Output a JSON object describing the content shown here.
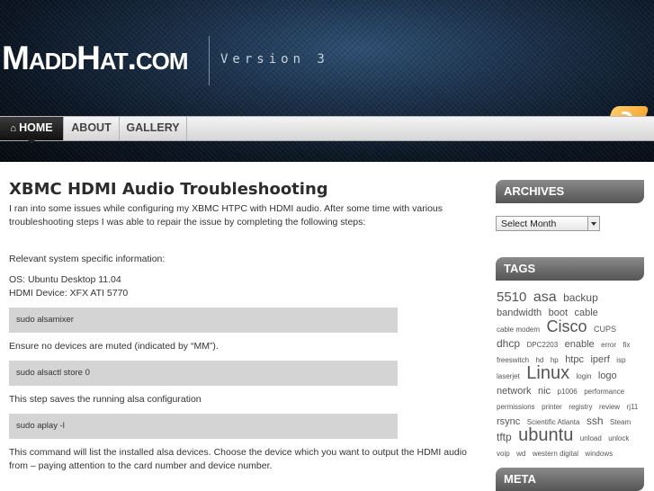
{
  "header": {
    "logo": "MaddHat.com",
    "tagline": "Version 3"
  },
  "nav": {
    "items": [
      {
        "label": "HOME",
        "active": true
      },
      {
        "label": "ABOUT",
        "active": false
      },
      {
        "label": "GALLERY",
        "active": false
      }
    ]
  },
  "post": {
    "title": "XBMC HDMI Audio Troubleshooting",
    "intro": "I ran into some issues while configuring my XBMC HTPC with HDMI audio.  After some time with various troubleshooting steps I was able to repair the issue by completing the following steps:",
    "relevant": "Relevant system specific information:",
    "os": "OS: Ubuntu Desktop 11.04",
    "hdmi": "HDMI Device: XFX ATI 5770",
    "cmd1": "sudo alsamixer",
    "note1": "Ensure no devices are muted (indicated by “MM”).",
    "cmd2": "sudo alsactl store 0",
    "note2": "This step saves the running alsa configuration",
    "cmd3": "sudo aplay -l",
    "note3": "This command will list the installed alsa devices.  Choose the device which you want to output the HDMI audio from – paying attention to the card number and device number."
  },
  "sidebar": {
    "archives_title": "ARCHIVES",
    "select_placeholder": "Select Month",
    "tags_title": "TAGS",
    "meta_title": "META",
    "tags": [
      {
        "t": "5510",
        "s": 15
      },
      {
        "t": "asa",
        "s": 16
      },
      {
        "t": "backup",
        "s": 12
      },
      {
        "t": "bandwidth",
        "s": 11
      },
      {
        "t": "boot",
        "s": 11
      },
      {
        "t": "cable",
        "s": 11
      },
      {
        "t": "cable modem",
        "s": 8
      },
      {
        "t": "Cisco",
        "s": 18
      },
      {
        "t": "CUPS",
        "s": 9
      },
      {
        "t": "dhcp",
        "s": 12
      },
      {
        "t": "DPC2203",
        "s": 8
      },
      {
        "t": "enable",
        "s": 11
      },
      {
        "t": "error",
        "s": 8
      },
      {
        "t": "fix",
        "s": 8
      },
      {
        "t": "freeswitch",
        "s": 8
      },
      {
        "t": "hd",
        "s": 8
      },
      {
        "t": "hp",
        "s": 8
      },
      {
        "t": "htpc",
        "s": 11
      },
      {
        "t": "iperf",
        "s": 11
      },
      {
        "t": "isp",
        "s": 8
      },
      {
        "t": "laserjet",
        "s": 8
      },
      {
        "t": "Linux",
        "s": 20
      },
      {
        "t": "login",
        "s": 8
      },
      {
        "t": "logo",
        "s": 11
      },
      {
        "t": "network",
        "s": 11
      },
      {
        "t": "nic",
        "s": 11
      },
      {
        "t": "p1006",
        "s": 8
      },
      {
        "t": "performance",
        "s": 8
      },
      {
        "t": "permissions",
        "s": 8
      },
      {
        "t": "printer",
        "s": 8
      },
      {
        "t": "registry",
        "s": 8
      },
      {
        "t": "review",
        "s": 8
      },
      {
        "t": "rj11",
        "s": 8
      },
      {
        "t": "rsync",
        "s": 11
      },
      {
        "t": "Scientific Atlanta",
        "s": 8
      },
      {
        "t": "ssh",
        "s": 12
      },
      {
        "t": "Steam",
        "s": 8
      },
      {
        "t": "tftp",
        "s": 12
      },
      {
        "t": "ubuntu",
        "s": 20
      },
      {
        "t": "unload",
        "s": 8
      },
      {
        "t": "unlock",
        "s": 8
      },
      {
        "t": "voip",
        "s": 8
      },
      {
        "t": "wd",
        "s": 8
      },
      {
        "t": "western digital",
        "s": 8
      },
      {
        "t": "windows",
        "s": 8
      }
    ]
  }
}
